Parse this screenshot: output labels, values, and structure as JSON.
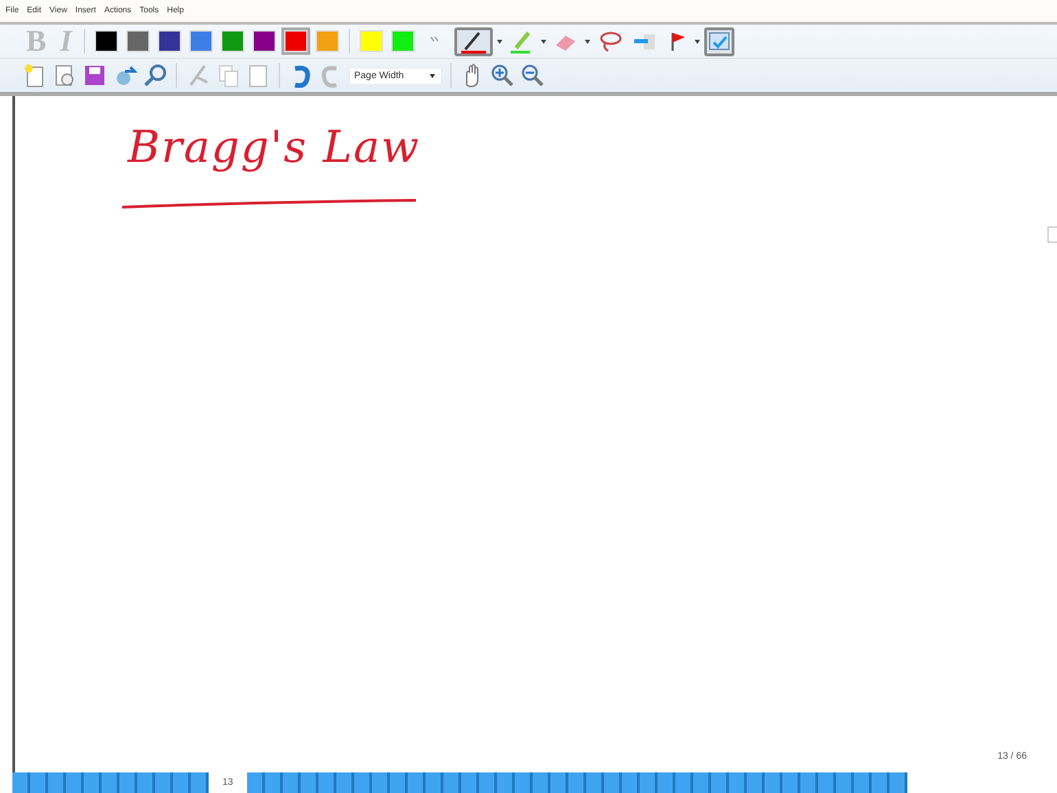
{
  "menu": [
    "File",
    "Edit",
    "View",
    "Insert",
    "Actions",
    "Tools",
    "Help"
  ],
  "format_buttons": [
    {
      "label": "B",
      "kind": "bold"
    },
    {
      "label": "I",
      "kind": "italic"
    }
  ],
  "colors": [
    {
      "color": "#000000",
      "selected": false
    },
    {
      "color": "#666666",
      "selected": false
    },
    {
      "color": "#333399",
      "selected": false
    },
    {
      "color": "#3d7fe6",
      "selected": false
    },
    {
      "color": "#119911",
      "selected": false
    },
    {
      "color": "#880088",
      "selected": false
    },
    {
      "color": "#ee0000",
      "selected": true
    },
    {
      "color": "#f0a010",
      "selected": false
    },
    {
      "color": "#ffff00",
      "selected": false
    },
    {
      "color": "#11ee11",
      "selected": false
    }
  ],
  "tools": [
    {
      "kind": "pen",
      "selected": true
    },
    {
      "kind": "highlighter",
      "selected": false
    },
    {
      "kind": "eraser",
      "selected": false
    },
    {
      "kind": "lasso",
      "selected": false
    },
    {
      "kind": "insert",
      "selected": false
    },
    {
      "kind": "flag",
      "selected": false
    },
    {
      "kind": "panel",
      "selected": true
    }
  ],
  "zoom_select": {
    "value": "Page Width"
  },
  "ink": {
    "text": "Bragg's Law"
  },
  "page_counter": "13 / 66",
  "page_strip": {
    "current": "13"
  }
}
